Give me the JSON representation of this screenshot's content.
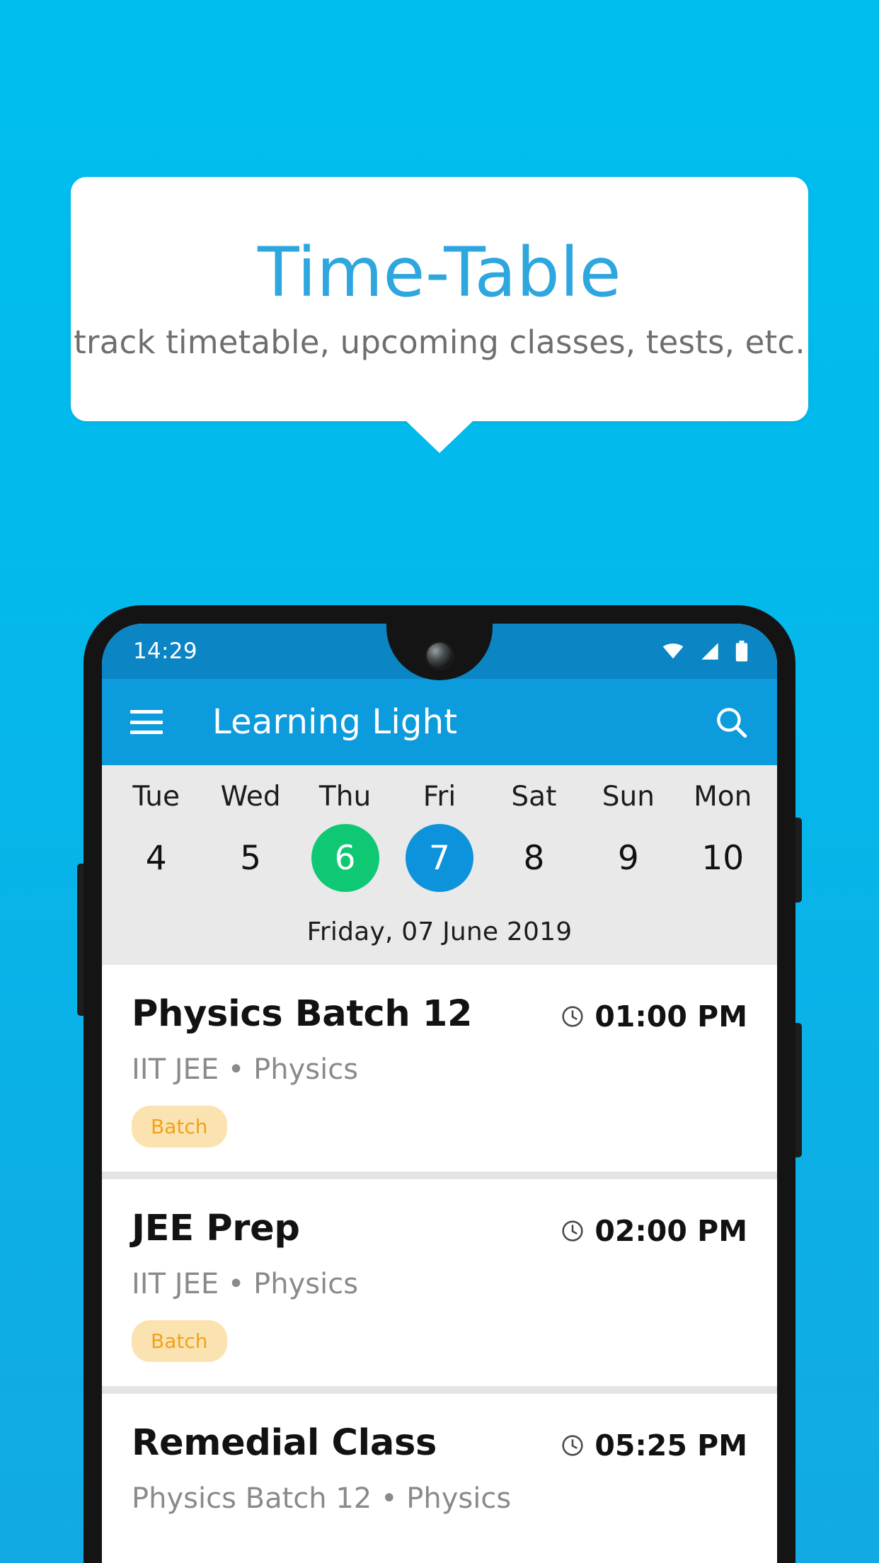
{
  "promo": {
    "title": "Time-Table",
    "subtitle": "track timetable, upcoming classes, tests, etc.",
    "title_color": "#2EA6DE",
    "background_color": "#00BCEC"
  },
  "phone": {
    "statusbar": {
      "time": "14:29",
      "icons": [
        "wifi-icon",
        "signal-icon",
        "battery-icon"
      ],
      "background_color": "#0B85C4"
    },
    "appbar": {
      "menu_icon": "hamburger-menu-icon",
      "title": "Learning Light",
      "search_icon": "search-icon",
      "background_color": "#0C9BDC"
    },
    "daystrip": {
      "background_color": "#E9E9E9",
      "today_color": "#0FC873",
      "selected_color": "#0D93DC",
      "days": [
        {
          "name": "Tue",
          "num": "4",
          "state": ""
        },
        {
          "name": "Wed",
          "num": "5",
          "state": ""
        },
        {
          "name": "Thu",
          "num": "6",
          "state": "today"
        },
        {
          "name": "Fri",
          "num": "7",
          "state": "selected"
        },
        {
          "name": "Sat",
          "num": "8",
          "state": ""
        },
        {
          "name": "Sun",
          "num": "9",
          "state": ""
        },
        {
          "name": "Mon",
          "num": "10",
          "state": ""
        }
      ],
      "date_label": "Friday, 07 June 2019"
    },
    "events": [
      {
        "title": "Physics Batch 12",
        "time": "01:00 PM",
        "subtitle": "IIT JEE • Physics",
        "badge": "Batch",
        "clock_icon": "clock-icon"
      },
      {
        "title": "JEE Prep",
        "time": "02:00 PM",
        "subtitle": "IIT JEE • Physics",
        "badge": "Batch",
        "clock_icon": "clock-icon"
      },
      {
        "title": "Remedial Class",
        "time": "05:25 PM",
        "subtitle": "Physics Batch 12 • Physics",
        "badge": "",
        "clock_icon": "clock-icon"
      }
    ]
  }
}
